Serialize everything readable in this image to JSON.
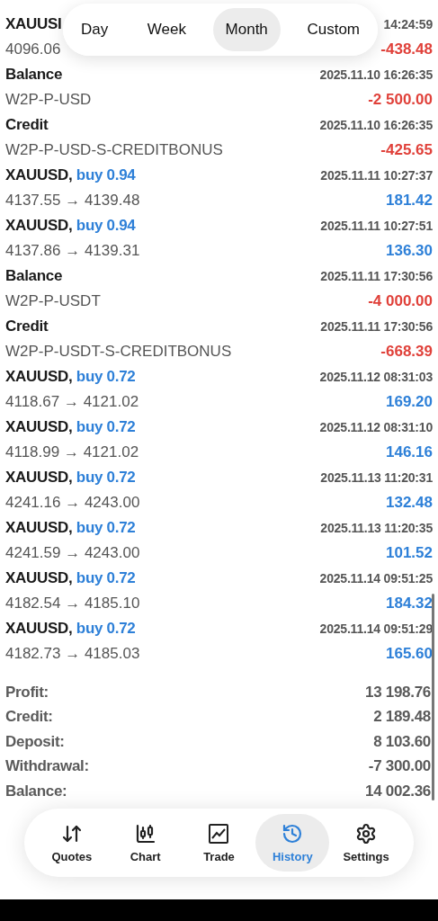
{
  "period_tabs": [
    {
      "label": "Day",
      "selected": false
    },
    {
      "label": "Week",
      "selected": false
    },
    {
      "label": "Month",
      "selected": true
    },
    {
      "label": "Custom",
      "selected": false
    }
  ],
  "partial_row": {
    "title": "XAUUSI",
    "prices": "4096.06",
    "time": "14:24:59",
    "amount": "-438.48",
    "color": "#e0413a"
  },
  "rows": [
    {
      "kind": "balance",
      "title": "Balance",
      "detail": "W2P-P-USD",
      "time": "2025.11.10 16:26:35",
      "amount": "-2 500.00",
      "color": "#e0413a"
    },
    {
      "kind": "credit",
      "title": "Credit",
      "detail": "W2P-P-USD-S-CREDITBONUS",
      "time": "2025.11.10 16:26:35",
      "amount": "-425.65",
      "color": "#e0413a"
    },
    {
      "kind": "trade",
      "title": "XAUUSD,",
      "side": "buy 0.94",
      "detail": "4137.55 → 4139.48",
      "time": "2025.11.11 10:27:37",
      "amount": "181.42",
      "color": "#2e80d8"
    },
    {
      "kind": "trade",
      "title": "XAUUSD,",
      "side": "buy 0.94",
      "detail": "4137.86 → 4139.31",
      "time": "2025.11.11 10:27:51",
      "amount": "136.30",
      "color": "#2e80d8"
    },
    {
      "kind": "balance",
      "title": "Balance",
      "detail": "W2P-P-USDT",
      "time": "2025.11.11 17:30:56",
      "amount": "-4 000.00",
      "color": "#e0413a"
    },
    {
      "kind": "credit",
      "title": "Credit",
      "detail": "W2P-P-USDT-S-CREDITBONUS",
      "time": "2025.11.11 17:30:56",
      "amount": "-668.39",
      "color": "#e0413a"
    },
    {
      "kind": "trade",
      "title": "XAUUSD,",
      "side": "buy 0.72",
      "detail": "4118.67 → 4121.02",
      "time": "2025.11.12 08:31:03",
      "amount": "169.20",
      "color": "#2e80d8"
    },
    {
      "kind": "trade",
      "title": "XAUUSD,",
      "side": "buy 0.72",
      "detail": "4118.99 → 4121.02",
      "time": "2025.11.12 08:31:10",
      "amount": "146.16",
      "color": "#2e80d8"
    },
    {
      "kind": "trade",
      "title": "XAUUSD,",
      "side": "buy 0.72",
      "detail": "4241.16 → 4243.00",
      "time": "2025.11.13 11:20:31",
      "amount": "132.48",
      "color": "#2e80d8"
    },
    {
      "kind": "trade",
      "title": "XAUUSD,",
      "side": "buy 0.72",
      "detail": "4241.59 → 4243.00",
      "time": "2025.11.13 11:20:35",
      "amount": "101.52",
      "color": "#2e80d8"
    },
    {
      "kind": "trade",
      "title": "XAUUSD,",
      "side": "buy 0.72",
      "detail": "4182.54 → 4185.10",
      "time": "2025.11.14 09:51:25",
      "amount": "184.32",
      "color": "#2e80d8"
    },
    {
      "kind": "trade",
      "title": "XAUUSD,",
      "side": "buy 0.72",
      "detail": "4182.73 → 4185.03",
      "time": "2025.11.14 09:51:29",
      "amount": "165.60",
      "color": "#2e80d8"
    }
  ],
  "summary": [
    {
      "label": "Profit:",
      "value": "13 198.76"
    },
    {
      "label": "Credit:",
      "value": "2 189.48"
    },
    {
      "label": "Deposit:",
      "value": "8 103.60"
    },
    {
      "label": "Withdrawal:",
      "value": "-7 300.00"
    },
    {
      "label": "Balance:",
      "value": "14 002.36"
    }
  ],
  "nav": [
    {
      "kind": "quotes",
      "label": "Quotes",
      "selected": false
    },
    {
      "kind": "chart",
      "label": "Chart",
      "selected": false
    },
    {
      "kind": "trade",
      "label": "Trade",
      "selected": false
    },
    {
      "kind": "history",
      "label": "History",
      "selected": true
    },
    {
      "kind": "settings",
      "label": "Settings",
      "selected": false
    }
  ]
}
